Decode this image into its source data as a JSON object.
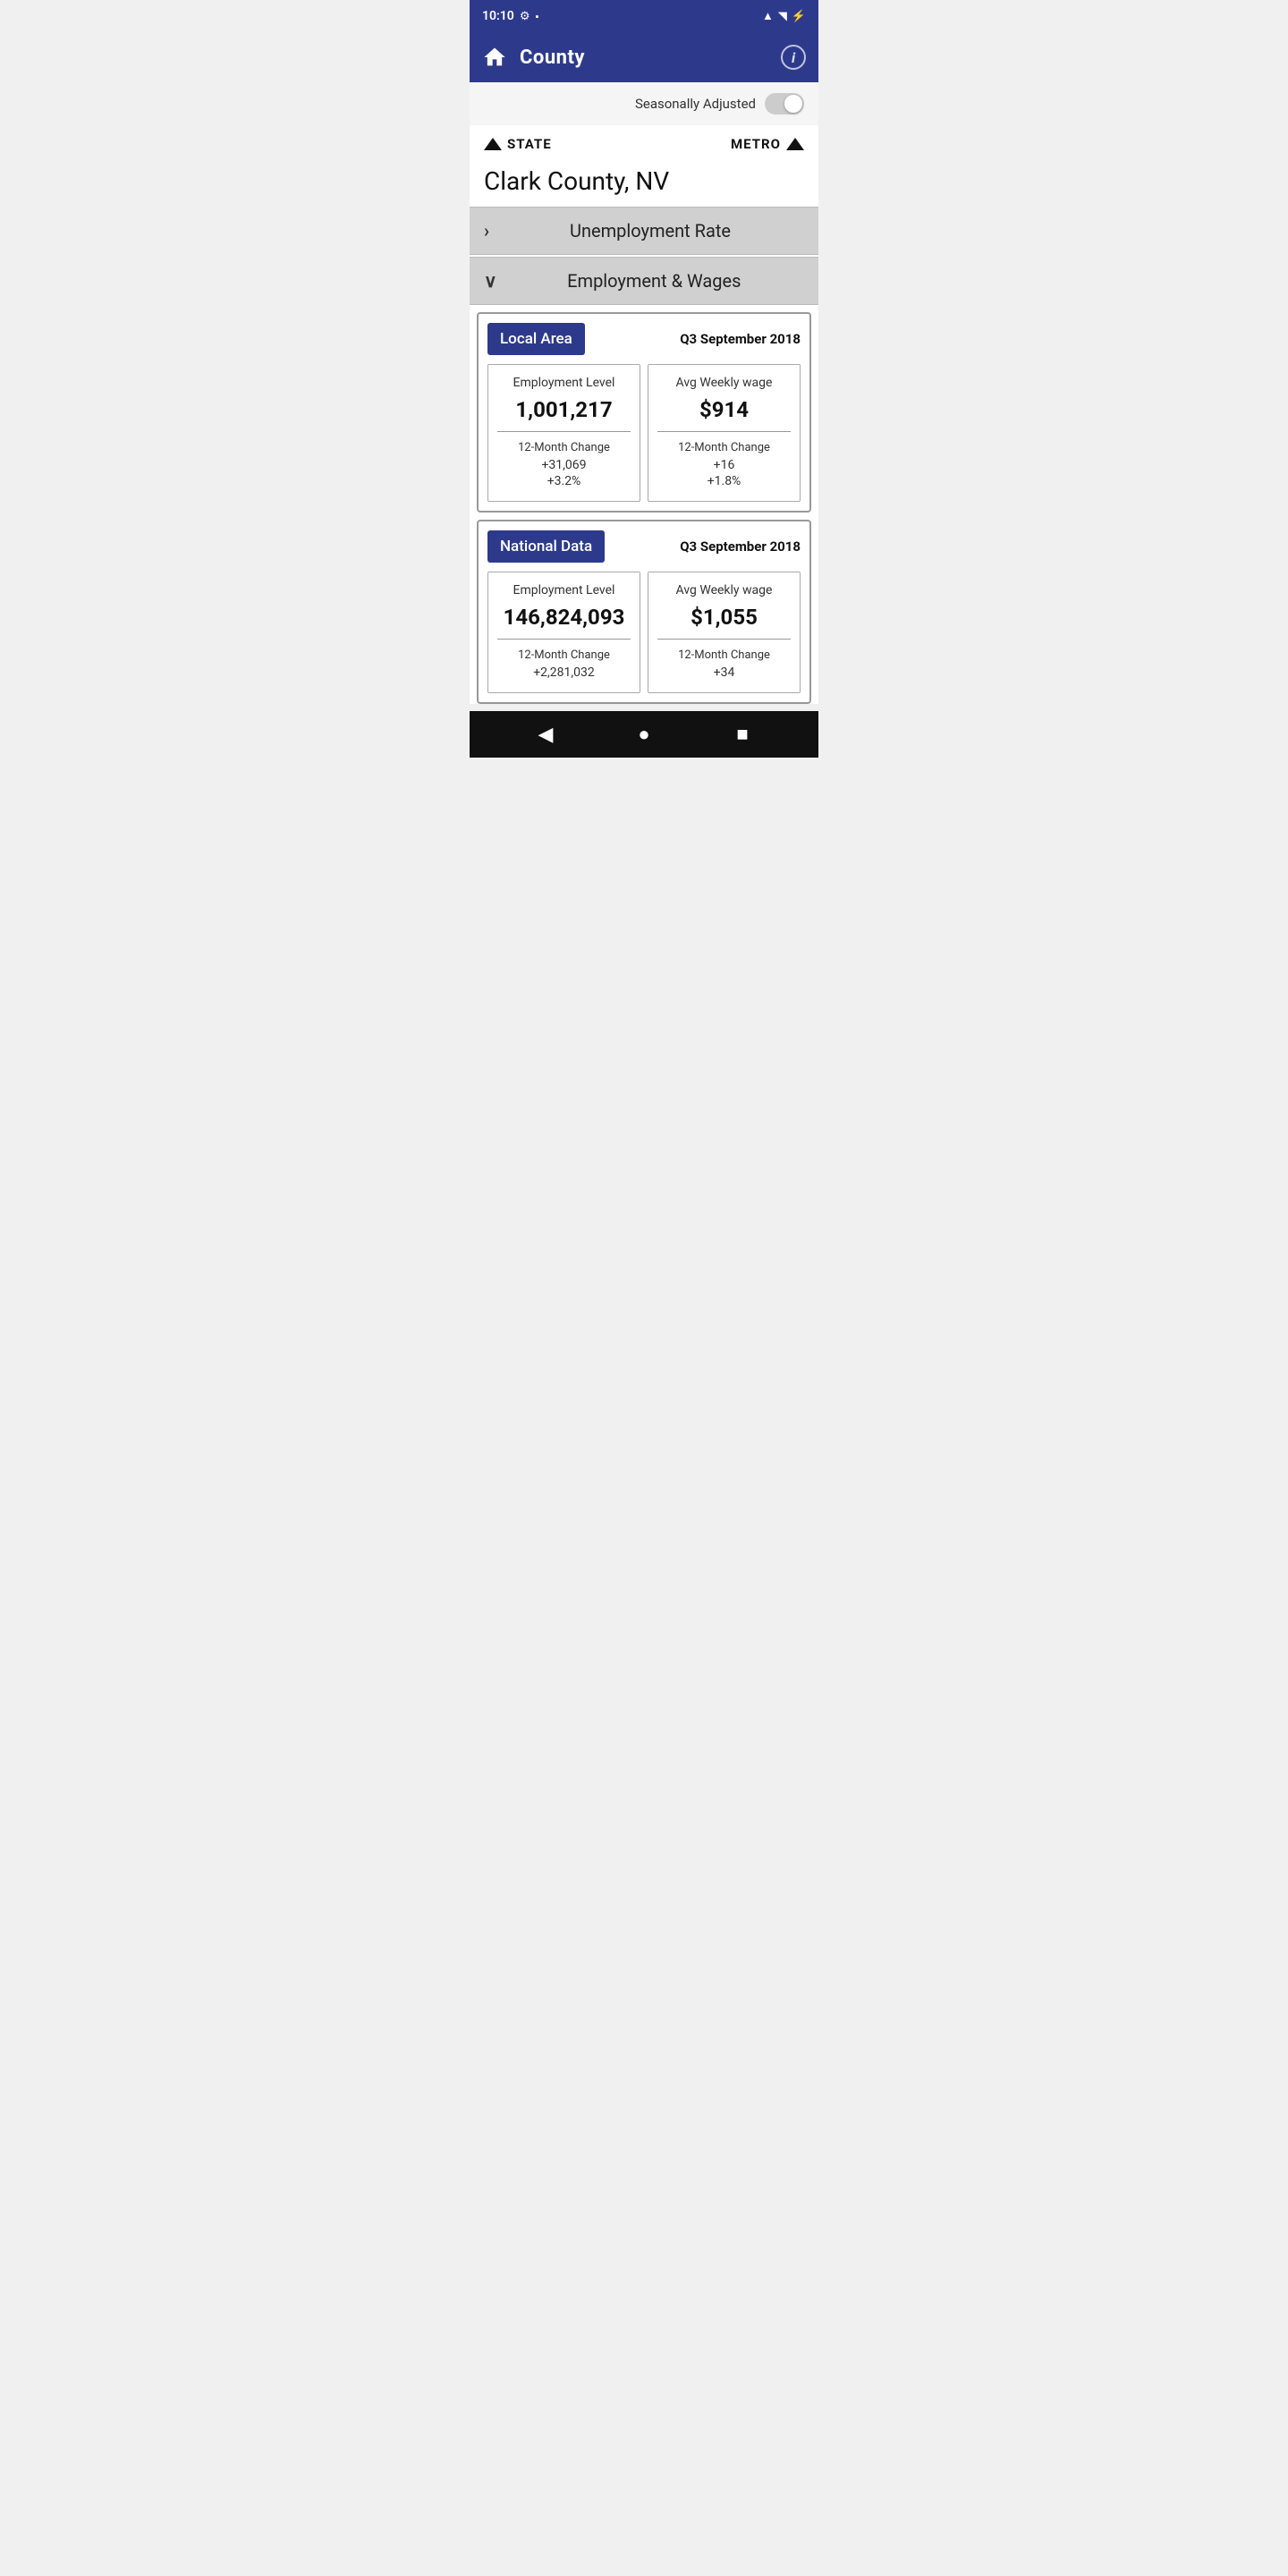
{
  "statusBar": {
    "time": "10:10",
    "icons": [
      "gear",
      "sd-card",
      "wifi",
      "signal",
      "battery"
    ]
  },
  "appBar": {
    "title": "County",
    "homeIconLabel": "home-icon",
    "infoIconLabel": "i"
  },
  "seasonallyAdjusted": {
    "label": "Seasonally Adjusted",
    "toggleOn": false
  },
  "navigation": {
    "stateLabel": "STATE",
    "metroLabel": "METRO"
  },
  "countyName": "Clark County, NV",
  "sections": [
    {
      "id": "unemployment",
      "label": "Unemployment Rate",
      "expanded": false,
      "chevron": "›"
    },
    {
      "id": "employment-wages",
      "label": "Employment & Wages",
      "expanded": true,
      "chevron": "∨"
    }
  ],
  "localAreaCard": {
    "badge": "Local Area",
    "date": "Q3 September 2018",
    "employmentLevel": {
      "label": "Employment Level",
      "value": "1,001,217",
      "changeLabel": "12-Month Change",
      "changeAbsolute": "+31,069",
      "changePercent": "+3.2%"
    },
    "avgWeeklyWage": {
      "label": "Avg Weekly wage",
      "value": "$914",
      "changeLabel": "12-Month Change",
      "changeAbsolute": "+16",
      "changePercent": "+1.8%"
    }
  },
  "nationalDataCard": {
    "badge": "National Data",
    "date": "Q3 September 2018",
    "employmentLevel": {
      "label": "Employment Level",
      "value": "146,824,093",
      "changeLabel": "12-Month Change",
      "changeAbsolute": "+2,281,032",
      "changePercent": ""
    },
    "avgWeeklyWage": {
      "label": "Avg Weekly wage",
      "value": "$1,055",
      "changeLabel": "12-Month Change",
      "changeAbsolute": "+34",
      "changePercent": ""
    }
  },
  "bottomNav": {
    "backLabel": "◀",
    "homeLabel": "●",
    "recentLabel": "■"
  }
}
